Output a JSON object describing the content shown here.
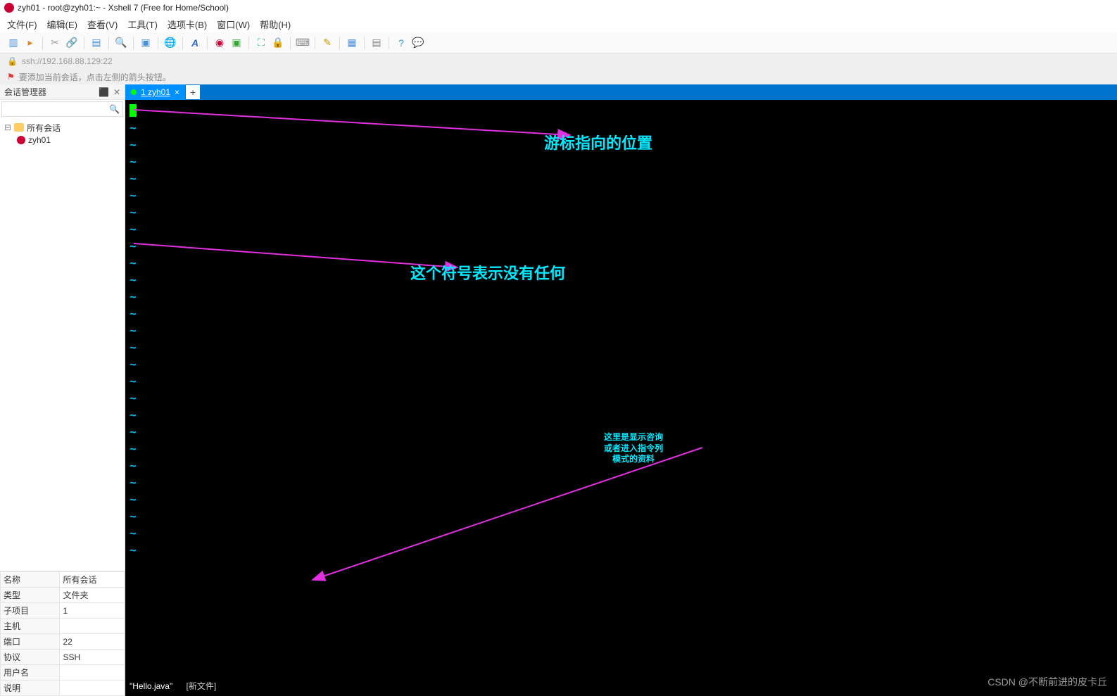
{
  "titlebar": {
    "title": "zyh01 - root@zyh01:~ - Xshell 7 (Free for Home/School)"
  },
  "menubar": {
    "items": [
      "文件(F)",
      "编辑(E)",
      "查看(V)",
      "工具(T)",
      "选项卡(B)",
      "窗口(W)",
      "帮助(H)"
    ]
  },
  "addrbar": {
    "text": "ssh://192.168.88.129:22"
  },
  "tipbar": {
    "text": "要添加当前会话，点击左侧的箭头按钮。"
  },
  "sidebar": {
    "title": "会话管理器",
    "tree": {
      "root": "所有会话",
      "child": "zyh01"
    },
    "props": [
      {
        "k": "名称",
        "v": "所有会话"
      },
      {
        "k": "类型",
        "v": "文件夹"
      },
      {
        "k": "子项目",
        "v": "1"
      },
      {
        "k": "主机",
        "v": ""
      },
      {
        "k": "端口",
        "v": "22"
      },
      {
        "k": "协议",
        "v": "SSH"
      },
      {
        "k": "用户名",
        "v": ""
      },
      {
        "k": "说明",
        "v": ""
      }
    ]
  },
  "tab": {
    "label": "1 zyh01"
  },
  "terminal": {
    "status_file": "\"Hello.java\"",
    "status_info": "[新文件]",
    "tilde_count": 26
  },
  "annotations": {
    "a1": "游标指向的位置",
    "a2": "这个符号表示没有任何",
    "a3_l1": "这里是显示咨询",
    "a3_l2": "或者进入指令列",
    "a3_l3": "模式的资料"
  },
  "watermark": "CSDN @不断前进的皮卡丘",
  "icons": {
    "search": "🔍",
    "lock": "🔒",
    "globe": "🌐",
    "font": "A",
    "refresh": "⟳",
    "folder": "📁",
    "new": "▦",
    "open": "▦",
    "help": "?",
    "comment": "💬",
    "flag": "⚑"
  }
}
